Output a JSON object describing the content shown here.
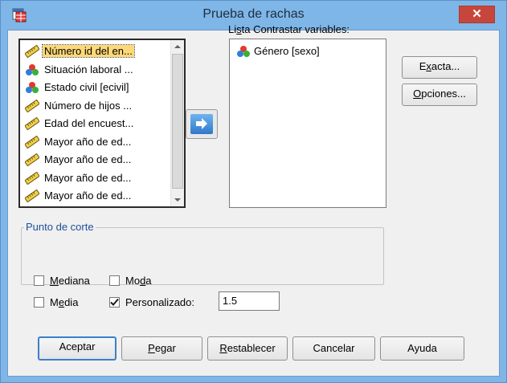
{
  "window": {
    "title": "Prueba de rachas",
    "close_glyph": "✕"
  },
  "source_list": {
    "items": [
      {
        "label": "Número id del en...",
        "icon": "scale-ruler-icon",
        "selected": true
      },
      {
        "label": "Situación laboral ...",
        "icon": "nominal-balls-icon"
      },
      {
        "label": "Estado civil [ecivil]",
        "icon": "nominal-balls-icon"
      },
      {
        "label": "Número de hijos ...",
        "icon": "scale-ruler-icon"
      },
      {
        "label": "Edad del encuest...",
        "icon": "scale-ruler-icon"
      },
      {
        "label": "Mayor año de ed...",
        "icon": "scale-ruler-icon"
      },
      {
        "label": "Mayor año de ed...",
        "icon": "scale-ruler-icon"
      },
      {
        "label": "Mayor año de ed...",
        "icon": "scale-ruler-icon"
      },
      {
        "label": "Mayor año de ed...",
        "icon": "scale-ruler-icon"
      }
    ]
  },
  "target": {
    "label_prefix": "Li",
    "label_mnemonic": "s",
    "label_suffix": "ta Contrastar variables:",
    "items": [
      {
        "label": "Género [sexo]",
        "icon": "nominal-balls-icon"
      }
    ]
  },
  "side_buttons": {
    "exacta_pre": "E",
    "exacta_mn": "x",
    "exacta_post": "acta...",
    "opciones_pre": "",
    "opciones_mn": "O",
    "opciones_post": "pciones..."
  },
  "cut_point": {
    "legend": "Punto de corte",
    "mediana_mn": "M",
    "mediana_post": "ediana",
    "mediana_checked": false,
    "moda_pre": "Mo",
    "moda_mn": "d",
    "moda_post": "a",
    "moda_checked": false,
    "media_pre": "M",
    "media_mn": "e",
    "media_post": "dia",
    "media_checked": false,
    "personalizado_label": "Personalizado:",
    "personalizado_checked": true,
    "personalizado_value": "1.5"
  },
  "footer_buttons": {
    "aceptar": "Aceptar",
    "pegar_mn": "P",
    "pegar_post": "egar",
    "restablecer_mn": "R",
    "restablecer_post": "establecer",
    "cancelar": "Cancelar",
    "ayuda": "Ayuda"
  },
  "colors": {
    "title_bar": "#7fb6e8",
    "close_button": "#c7463b",
    "selection": "#fcd878",
    "legend_text": "#1f4f9a",
    "focus_border": "#3c7fc8"
  }
}
